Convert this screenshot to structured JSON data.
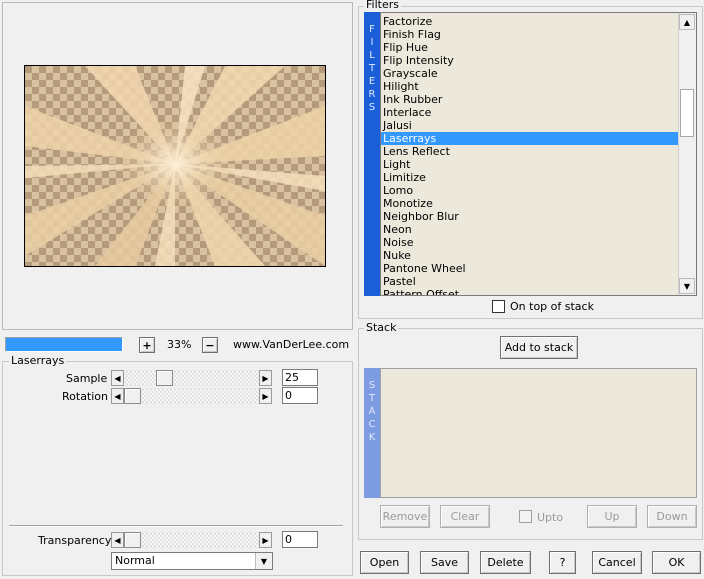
{
  "preview": {
    "zoom": "33%",
    "zoom_in": "+",
    "zoom_out": "−",
    "website": "www.VanDerLee.com"
  },
  "filters": {
    "title": "Filters",
    "sidebar_letters": [
      "F",
      "I",
      "L",
      "T",
      "E",
      "R",
      "S"
    ],
    "items": [
      "Factorize",
      "Finish Flag",
      "Flip Hue",
      "Flip Intensity",
      "Grayscale",
      "Hilight",
      "Ink Rubber",
      "Interlace",
      "Jalusi",
      "Laserrays",
      "Lens Reflect",
      "Light",
      "Limitize",
      "Lomo",
      "Monotize",
      "Neighbor Blur",
      "Neon",
      "Noise",
      "Nuke",
      "Pantone Wheel",
      "Pastel",
      "Pattern Offset"
    ],
    "selected_index": 9,
    "on_top_label": "On top of stack"
  },
  "params": {
    "group_title": "Laserrays",
    "sample": {
      "label": "Sample",
      "value": "25",
      "fraction": 0.32
    },
    "rotation": {
      "label": "Rotation",
      "value": "0",
      "fraction": 0.0
    }
  },
  "transparency": {
    "label": "Transparency",
    "value": "0",
    "fraction": 0.0,
    "blend_mode": "Normal"
  },
  "stack": {
    "title": "Stack",
    "add_label": "Add to stack",
    "sidebar_letters": [
      "S",
      "T",
      "A",
      "C",
      "K"
    ],
    "remove_label": "Remove",
    "clear_label": "Clear",
    "upto_label": "Upto",
    "up_label": "Up",
    "down_label": "Down"
  },
  "footer": {
    "open": "Open",
    "save": "Save",
    "delete": "Delete",
    "help": "?",
    "cancel": "Cancel",
    "ok": "OK"
  },
  "colors": {
    "accent": "#1a5fd8",
    "selection": "#3399ff",
    "list_bg": "#ece8dc",
    "progress": "#3399ff"
  }
}
